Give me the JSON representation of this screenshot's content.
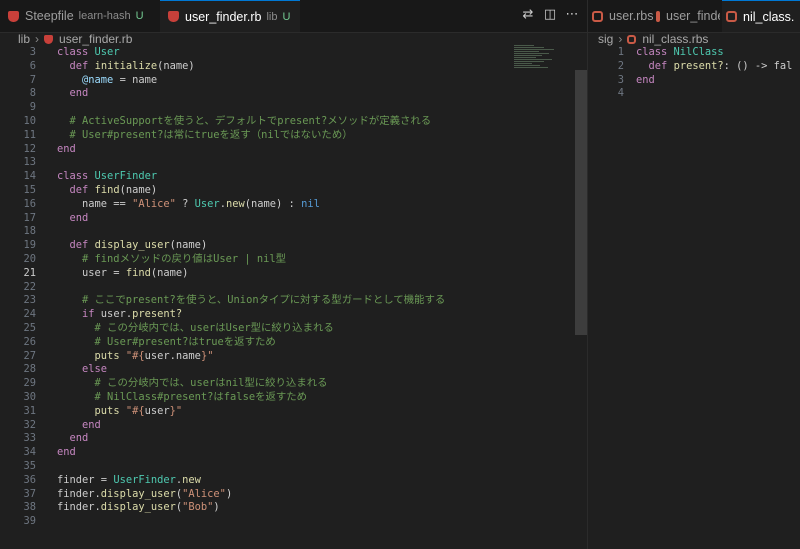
{
  "left_editor": {
    "tabs": [
      {
        "label": "Steepfile",
        "sub": "learn-hash",
        "badge": "U",
        "active": false
      },
      {
        "label": "user_finder.rb",
        "sub": "lib",
        "badge": "U",
        "active": true
      }
    ],
    "breadcrumb": [
      "lib",
      "user_finder.rb"
    ],
    "lines": [
      {
        "n": "3",
        "html": "<span class=\"kw\">class</span> <span class=\"cls\">User</span>"
      },
      {
        "n": "6",
        "html": "  <span class=\"kw\">def</span> <span class=\"fn\">initialize</span><span class=\"punc\">(</span>name<span class=\"punc\">)</span>"
      },
      {
        "n": "7",
        "html": "    <span class=\"ivar\">@name</span> = name"
      },
      {
        "n": "8",
        "html": "  <span class=\"kw\">end</span>"
      },
      {
        "n": "9",
        "html": ""
      },
      {
        "n": "10",
        "html": "  <span class=\"cm\"># ActiveSupportを使うと、デフォルトでpresent?メソッドが定義される</span>"
      },
      {
        "n": "11",
        "html": "  <span class=\"cm\"># User#present?は常にtrueを返す（nilではないため）</span>"
      },
      {
        "n": "12",
        "html": "<span class=\"kw\">end</span>"
      },
      {
        "n": "13",
        "html": ""
      },
      {
        "n": "14",
        "html": "<span class=\"kw\">class</span> <span class=\"cls\">UserFinder</span>"
      },
      {
        "n": "15",
        "html": "  <span class=\"kw\">def</span> <span class=\"fn\">find</span><span class=\"punc\">(</span>name<span class=\"punc\">)</span>"
      },
      {
        "n": "16",
        "html": "    name == <span class=\"str\">\"Alice\"</span> ? <span class=\"cls\">User</span>.<span class=\"fn\">new</span><span class=\"punc\">(</span>name<span class=\"punc\">)</span> : <span class=\"nil\">nil</span>"
      },
      {
        "n": "17",
        "html": "  <span class=\"kw\">end</span>"
      },
      {
        "n": "18",
        "html": ""
      },
      {
        "n": "19",
        "html": "  <span class=\"kw\">def</span> <span class=\"fn\">display_user</span><span class=\"punc\">(</span>name<span class=\"punc\">)</span>"
      },
      {
        "n": "20",
        "html": "    <span class=\"cm\"># findメソッドの戻り値はUser | nil型</span>"
      },
      {
        "n": "21",
        "html": "    user = <span class=\"fn\">find</span><span class=\"punc\">(</span>name<span class=\"punc\">)</span>",
        "current": true
      },
      {
        "n": "22",
        "html": ""
      },
      {
        "n": "23",
        "html": "    <span class=\"cm\"># ここでpresent?を使うと、Unionタイプに対する型ガードとして機能する</span>"
      },
      {
        "n": "24",
        "html": "    <span class=\"kw\">if</span> user.<span class=\"fn\">present?</span>"
      },
      {
        "n": "25",
        "html": "      <span class=\"cm\"># この分岐内では、userはUser型に絞り込まれる</span>"
      },
      {
        "n": "26",
        "html": "      <span class=\"cm\"># User#present?はtrueを返すため</span>"
      },
      {
        "n": "27",
        "html": "      <span class=\"fn\">puts</span> <span class=\"str\">\"#{</span>user.name<span class=\"str\">}\"</span>"
      },
      {
        "n": "28",
        "html": "    <span class=\"kw\">else</span>"
      },
      {
        "n": "29",
        "html": "      <span class=\"cm\"># この分岐内では、userはnil型に絞り込まれる</span>"
      },
      {
        "n": "30",
        "html": "      <span class=\"cm\"># NilClass#present?はfalseを返すため</span>"
      },
      {
        "n": "31",
        "html": "      <span class=\"fn\">puts</span> <span class=\"str\">\"#{</span>user<span class=\"str\">}\"</span>"
      },
      {
        "n": "32",
        "html": "    <span class=\"kw\">end</span>"
      },
      {
        "n": "33",
        "html": "  <span class=\"kw\">end</span>"
      },
      {
        "n": "34",
        "html": "<span class=\"kw\">end</span>"
      },
      {
        "n": "35",
        "html": ""
      },
      {
        "n": "36",
        "html": "finder = <span class=\"cls\">UserFinder</span>.<span class=\"fn\">new</span>"
      },
      {
        "n": "37",
        "html": "finder.<span class=\"fn\">display_user</span><span class=\"punc\">(</span><span class=\"str\">\"Alice\"</span><span class=\"punc\">)</span>"
      },
      {
        "n": "38",
        "html": "finder.<span class=\"fn\">display_user</span><span class=\"punc\">(</span><span class=\"str\">\"Bob\"</span><span class=\"punc\">)</span>"
      },
      {
        "n": "39",
        "html": ""
      }
    ]
  },
  "right_editor": {
    "tabs": [
      {
        "label": "user.rbs",
        "active": false
      },
      {
        "label": "user_finde",
        "active": false
      },
      {
        "label": "nil_class.",
        "active": true
      }
    ],
    "breadcrumb": [
      "sig",
      "nil_class.rbs"
    ],
    "lines": [
      {
        "n": "1",
        "html": "<span class=\"kw\">class</span> <span class=\"cls\">NilClass</span>"
      },
      {
        "n": "2",
        "html": "  <span class=\"kw\">def</span> <span class=\"fn\">present?</span>: () -&gt; fal"
      },
      {
        "n": "3",
        "html": "<span class=\"kw\">end</span>"
      },
      {
        "n": "4",
        "html": ""
      }
    ]
  },
  "colors": {
    "accent": "#0078d4",
    "background": "#1f1f1f",
    "tabbar": "#181818"
  }
}
